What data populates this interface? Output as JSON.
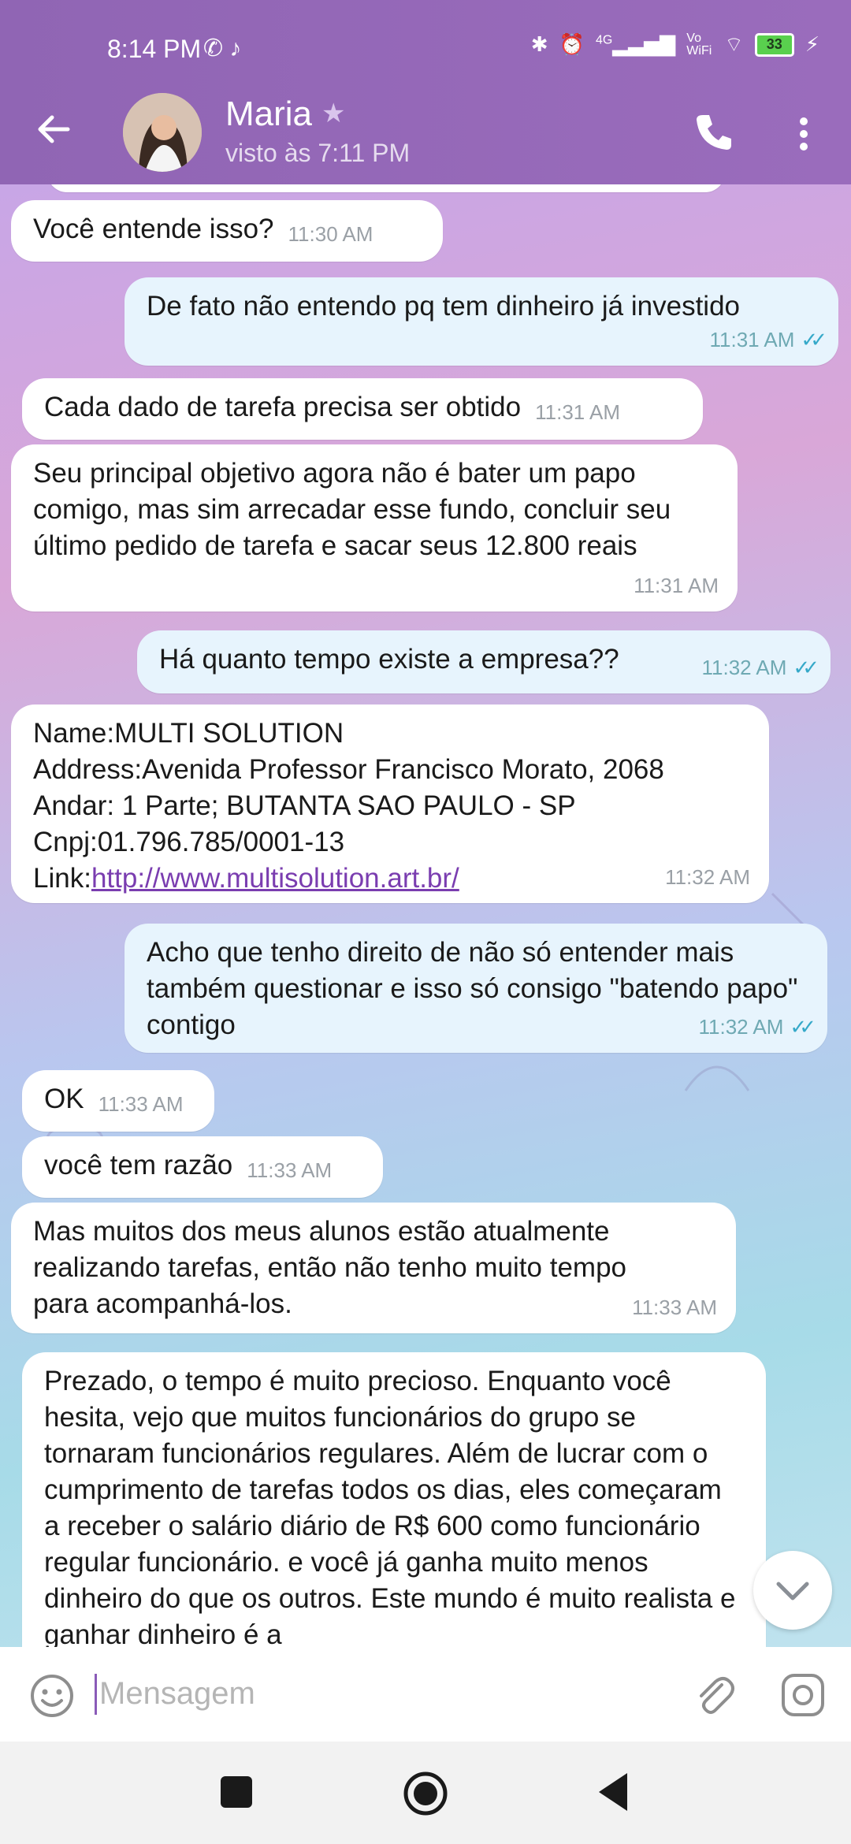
{
  "status_bar": {
    "time": "8:14 PM",
    "left_icons": [
      "whatsapp-icon",
      "tiktok-icon"
    ],
    "network": "4G",
    "vowifi": "Vo WiFi",
    "battery": "33"
  },
  "header": {
    "contact_name": "Maria",
    "last_seen": "visto às 7:11 PM"
  },
  "messages": [
    {
      "direction": "in",
      "text": "Você entende isso?",
      "time": "11:30 AM"
    },
    {
      "direction": "out",
      "text": "De fato não entendo pq tem dinheiro já investido",
      "time": "11:31 AM",
      "read": true
    },
    {
      "direction": "in",
      "text": "Cada dado de tarefa precisa ser obtido",
      "time": "11:31 AM"
    },
    {
      "direction": "in",
      "text": "Seu principal objetivo agora não é bater um papo comigo, mas sim arrecadar esse fundo, concluir seu último pedido de tarefa e sacar seus 12.800 reais",
      "time": "11:31 AM"
    },
    {
      "direction": "out",
      "text": "Há quanto tempo existe a empresa??",
      "time": "11:32 AM",
      "read": true
    },
    {
      "direction": "in",
      "lines": [
        "Name:MULTI SOLUTION",
        "Address:Avenida Professor Francisco Morato, 2068",
        "Andar: 1 Parte; BUTANTA SAO PAULO - SP",
        "Cnpj:01.796.785/0001-13"
      ],
      "link_label": "Link:",
      "link": "http://www.multisolution.art.br/",
      "time": "11:32 AM"
    },
    {
      "direction": "out",
      "text": "Acho que tenho direito de não só entender mais também questionar e isso só consigo \"batendo papo\" contigo",
      "time": "11:32 AM",
      "read": true
    },
    {
      "direction": "in",
      "text": "OK",
      "time": "11:33 AM"
    },
    {
      "direction": "in",
      "text": "você tem razão",
      "time": "11:33 AM"
    },
    {
      "direction": "in",
      "text": "Mas muitos dos meus alunos estão atualmente realizando tarefas, então não tenho muito tempo para acompanhá-los.",
      "time": "11:33 AM"
    },
    {
      "direction": "in",
      "text": "Prezado, o tempo é muito precioso. Enquanto você hesita, vejo que muitos funcionários do grupo se tornaram funcionários regulares. Além de lucrar com o cumprimento de tarefas todos os dias, eles começaram a receber o salário diário de R$ 600 como funcionário regular funcionário. e você já ganha muito menos dinheiro do que os outros. Este mundo é muito realista e ganhar dinheiro é a"
    }
  ],
  "input": {
    "placeholder": "Mensagem"
  },
  "colors": {
    "header": "#9065b4",
    "incoming_bubble": "#ffffff",
    "outgoing_bubble": "#e7f4fd",
    "read_ticks": "#36a9c9",
    "link": "#7a3db0"
  }
}
